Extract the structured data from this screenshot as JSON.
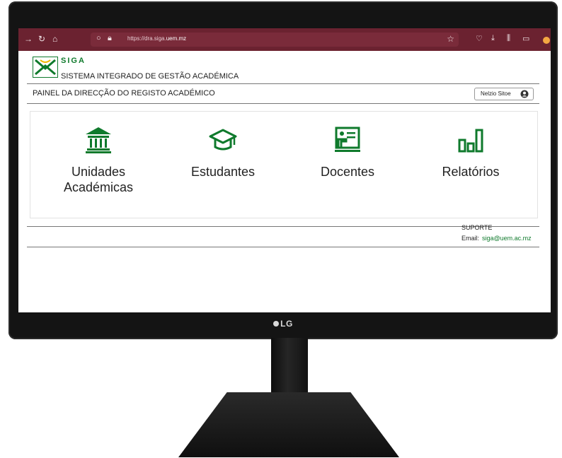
{
  "browser": {
    "url_prefix": "https://dra.siga.",
    "url_domain": "uem.mz",
    "toolbar_color": "#6b2230"
  },
  "header": {
    "logo_name": "SIGA",
    "logo_subtitle": "SISTEMA INTEGRADO DE GESTÃO ACADÉMICA",
    "panel_title": "PAINEL DA DIRECÇÃO DO REGISTO ACADÉMICO",
    "user_name": "Nelzio Sitoe"
  },
  "tiles": [
    {
      "label_line1": "Unidades",
      "label_line2": "Académicas",
      "icon": "institution-icon"
    },
    {
      "label_line1": "Estudantes",
      "label_line2": "",
      "icon": "graduation-cap-icon"
    },
    {
      "label_line1": "Docentes",
      "label_line2": "",
      "icon": "teacher-board-icon"
    },
    {
      "label_line1": "Relatórios",
      "label_line2": "",
      "icon": "bar-chart-icon"
    }
  ],
  "footer": {
    "support_label": "SUPORTE",
    "email_label": "Email:",
    "email": "siga@uem.ac.mz"
  },
  "monitor_brand": "LG",
  "colors": {
    "accent": "#0f7a2c",
    "toolbar": "#6b2230"
  }
}
